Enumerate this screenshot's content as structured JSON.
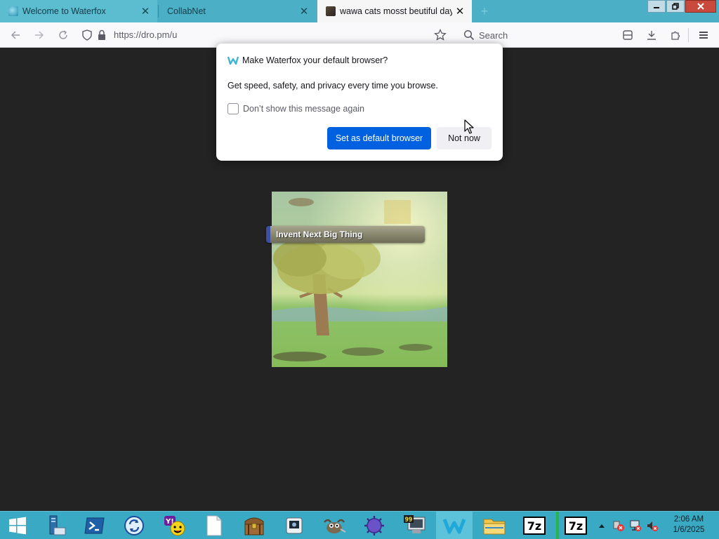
{
  "browser": {
    "tabs": [
      {
        "label": "Welcome to Waterfox",
        "active": false
      },
      {
        "label": "CollabNet",
        "active": false
      },
      {
        "label": "wawa cats mosst beutiful day.pn",
        "active": true
      }
    ],
    "new_tab_icon": "plus-icon",
    "url": "https://dro.pm/u",
    "search_placeholder": "Search"
  },
  "dialog": {
    "title": "Make Waterfox your default browser?",
    "body": "Get speed, safety, and privacy every time you browse.",
    "checkbox_label": "Don’t show this message again",
    "checkbox_checked": false,
    "primary_button": "Set as default browser",
    "secondary_button": "Not now"
  },
  "page": {
    "banner_text": "Invent Next Big Thing"
  },
  "taskbar": {
    "apps": [
      {
        "name": "start-icon"
      },
      {
        "name": "file-server-icon"
      },
      {
        "name": "powershell-icon"
      },
      {
        "name": "sync-icon"
      },
      {
        "name": "yahoo-messenger-icon"
      },
      {
        "name": "blank-document-icon"
      },
      {
        "name": "treasure-chest-icon"
      },
      {
        "name": "photo-viewer-icon"
      },
      {
        "name": "gimp-icon"
      },
      {
        "name": "virus-icon"
      },
      {
        "name": "monitor-99-icon"
      },
      {
        "name": "waterfox-icon"
      },
      {
        "name": "file-explorer-icon"
      },
      {
        "name": "7zip-icon"
      },
      {
        "name": "7zip-icon"
      }
    ],
    "seven_zip_label": "7z",
    "monitor_badge": "99",
    "clock_time": "2:06 AM",
    "clock_date": "1/6/2025"
  },
  "colors": {
    "tabstrip": "#4bb0c6",
    "taskbar": "#3aa9c4",
    "primary_button": "#0061e0",
    "page_background": "#232323"
  }
}
